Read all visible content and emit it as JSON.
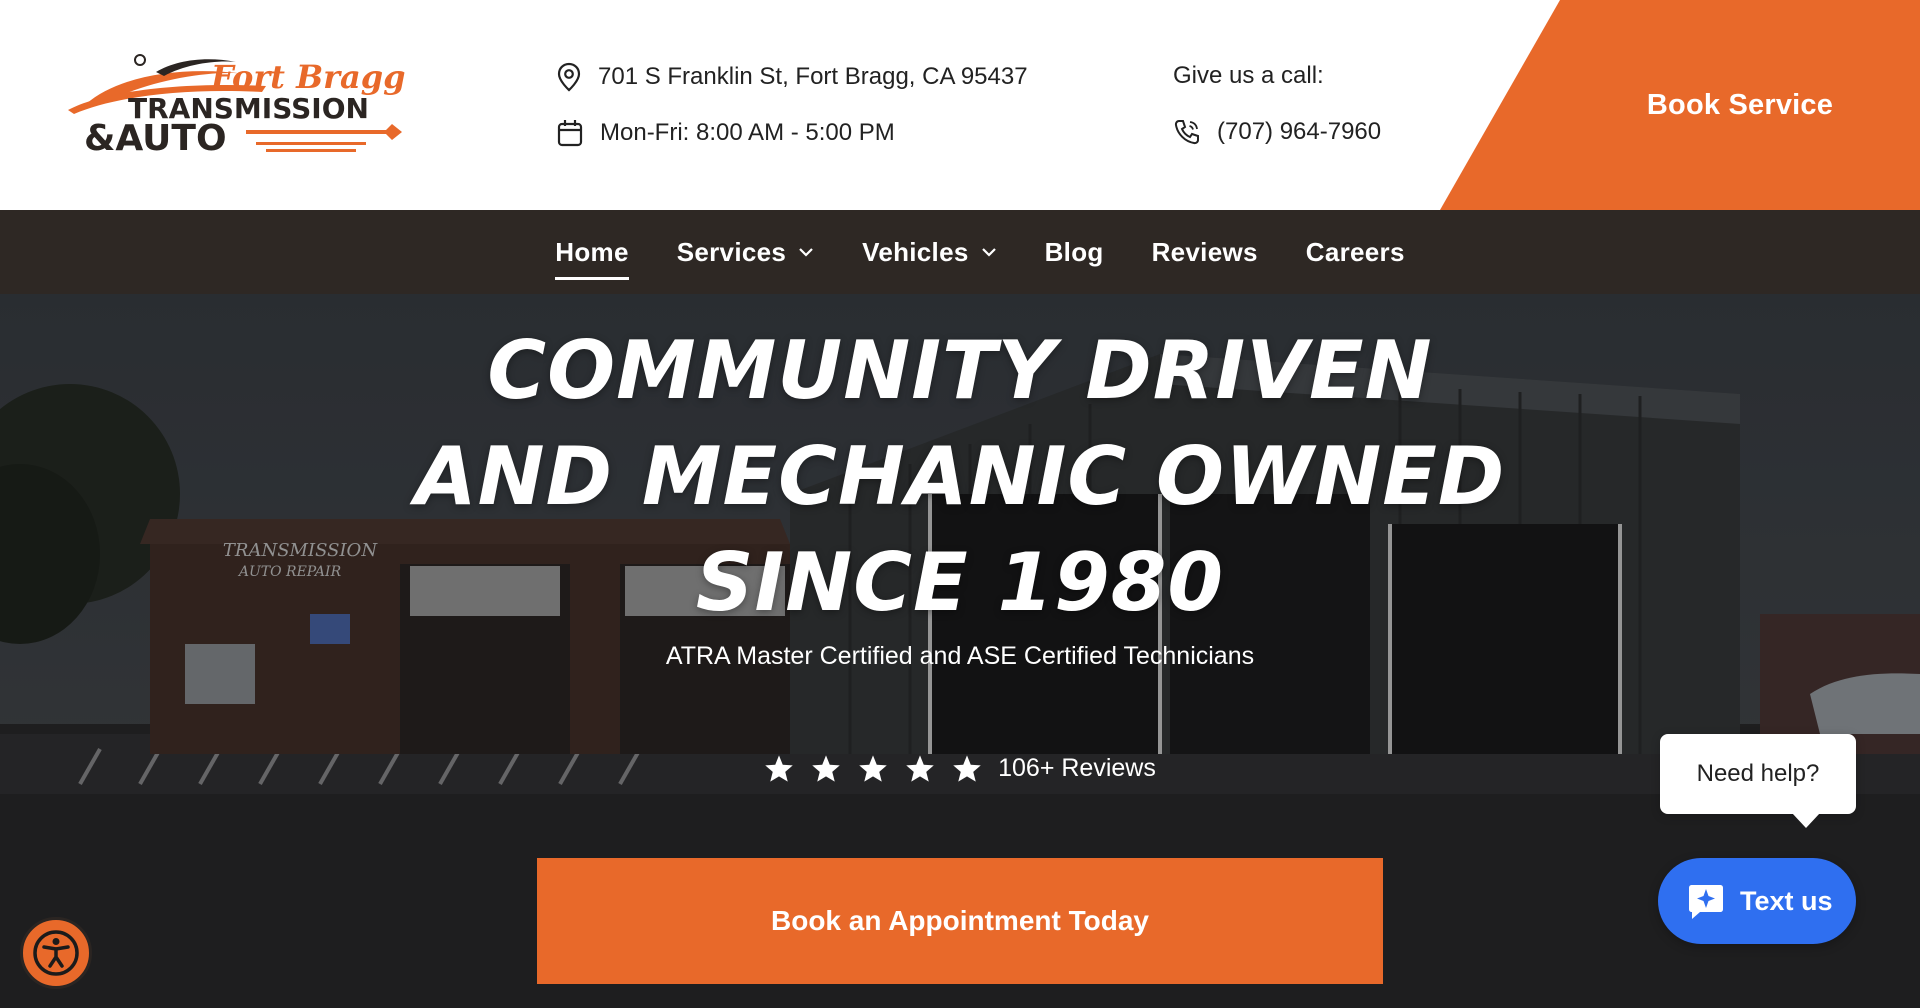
{
  "header": {
    "logo": {
      "line1": "Fort Bragg",
      "line2": "TRANSMISSION",
      "line3": "&AUTO"
    },
    "address": "701 S Franklin St, Fort Bragg, CA 95437",
    "hours": "Mon-Fri: 8:00 AM - 5:00 PM",
    "call_label": "Give us a call:",
    "phone": "(707) 964-7960",
    "book_service": "Book Service"
  },
  "nav": {
    "items": [
      {
        "label": "Home",
        "active": true
      },
      {
        "label": "Services",
        "dropdown": true
      },
      {
        "label": "Vehicles",
        "dropdown": true
      },
      {
        "label": "Blog"
      },
      {
        "label": "Reviews"
      },
      {
        "label": "Careers"
      }
    ]
  },
  "hero": {
    "title_lines": [
      "COMMUNITY DRIVEN",
      "AND MECHANIC OWNED",
      "SINCE 1980"
    ],
    "subtitle": "ATRA Master Certified and ASE Certified Technicians",
    "rating_stars": 5,
    "reviews": "106+ Reviews",
    "cta": "Book an Appointment Today",
    "sign_text_1": "TRANSMISSION",
    "sign_text_2": "AUTO REPAIR"
  },
  "widgets": {
    "help_text": "Need help?",
    "text_us": "Text us",
    "accessibility_icon": "accessibility-icon"
  },
  "colors": {
    "accent": "#e8692a",
    "nav_bg": "#2e2824",
    "chat_blue": "#2f6ff0"
  }
}
